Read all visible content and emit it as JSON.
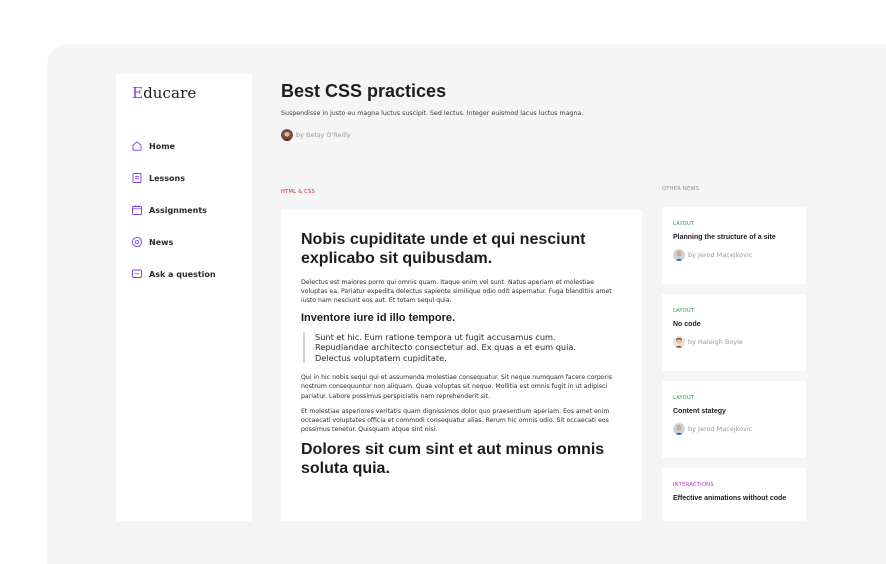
{
  "brand": {
    "first": "E",
    "rest": "ducare"
  },
  "nav": {
    "items": [
      {
        "label": "Home",
        "icon": "home-icon"
      },
      {
        "label": "Lessons",
        "icon": "document-icon"
      },
      {
        "label": "Assignments",
        "icon": "calendar-icon"
      },
      {
        "label": "News",
        "icon": "at-sign-icon"
      },
      {
        "label": "Ask a question",
        "icon": "chat-icon"
      }
    ]
  },
  "header": {
    "title": "Best CSS practices",
    "subtitle": "Suspendisse in justo eu magna luctus suscipit. Sed lectus. Integer euismod lacus luctus magna.",
    "author": "by Betsy O'Reilly"
  },
  "article": {
    "section": "HTML & CSS",
    "heading": "Nobis cupiditate unde et qui nesciunt explicabo sit quibusdam.",
    "paragraph1": "Delectus est maiores porro qui omnis quam. Itaque enim vel sunt. Natus aperiam et molestiae voluptas ea. Pariatur expedita delectus sapiente similique odio odit aspernatur. Fuga blanditiis amet iusto nam nesciunt eos aut. Et totam sequi quia.",
    "subheading": "Inventore iure id illo tempore.",
    "quote": "Sunt et hic. Eum ratione tempora ut fugit accusamus cum. Repudiandae architecto consectetur ad. Ex quas a et eum quia. Delectus voluptatem cupiditate.",
    "paragraph2": "Qui in hic nobis sequi qui et assumenda molestiae consequatur. Sit neque numquam facere corporis nostrum consequuntur non aliquam. Quae voluptas sit neque. Mollitia est omnis fugit in ut adipisci pariatur. Labore possimus perspiciatis nam reprehenderit sit.",
    "paragraph3": "Et molestiae asperiores veritatis quam dignissimos dolor quo praesentium aperiam. Eos amet enim occaecati voluptates officia et commodi consequatur alias. Rerum hic omnis odio. Sit occaecati eos possimus tenetur. Quisquam atque sint nisi.",
    "heading2": "Dolores sit cum sint et aut minus omnis soluta quia."
  },
  "other_news": {
    "label": "OTHER NEWS",
    "items": [
      {
        "tag": "LAYOUT",
        "tag_color": "#2e9b4a",
        "title": "Planning the structure of a site",
        "author": "by Jerod Macejkovic"
      },
      {
        "tag": "LAYOUT",
        "tag_color": "#2e9b4a",
        "title": "No code",
        "author": "by Haleigh Boyle"
      },
      {
        "tag": "LAYOUT",
        "tag_color": "#2e9b4a",
        "title": "Content stategy",
        "author": "by Jerod Macejkovic"
      },
      {
        "tag": "INTERACTIONS",
        "tag_color": "#b232c7",
        "title": "Effective animations without code",
        "author": ""
      }
    ]
  },
  "colors": {
    "accent": "#7c3aed",
    "section_label": "#c42b2b",
    "layout_tag": "#2e9b4a",
    "interactions_tag": "#b232c7"
  }
}
